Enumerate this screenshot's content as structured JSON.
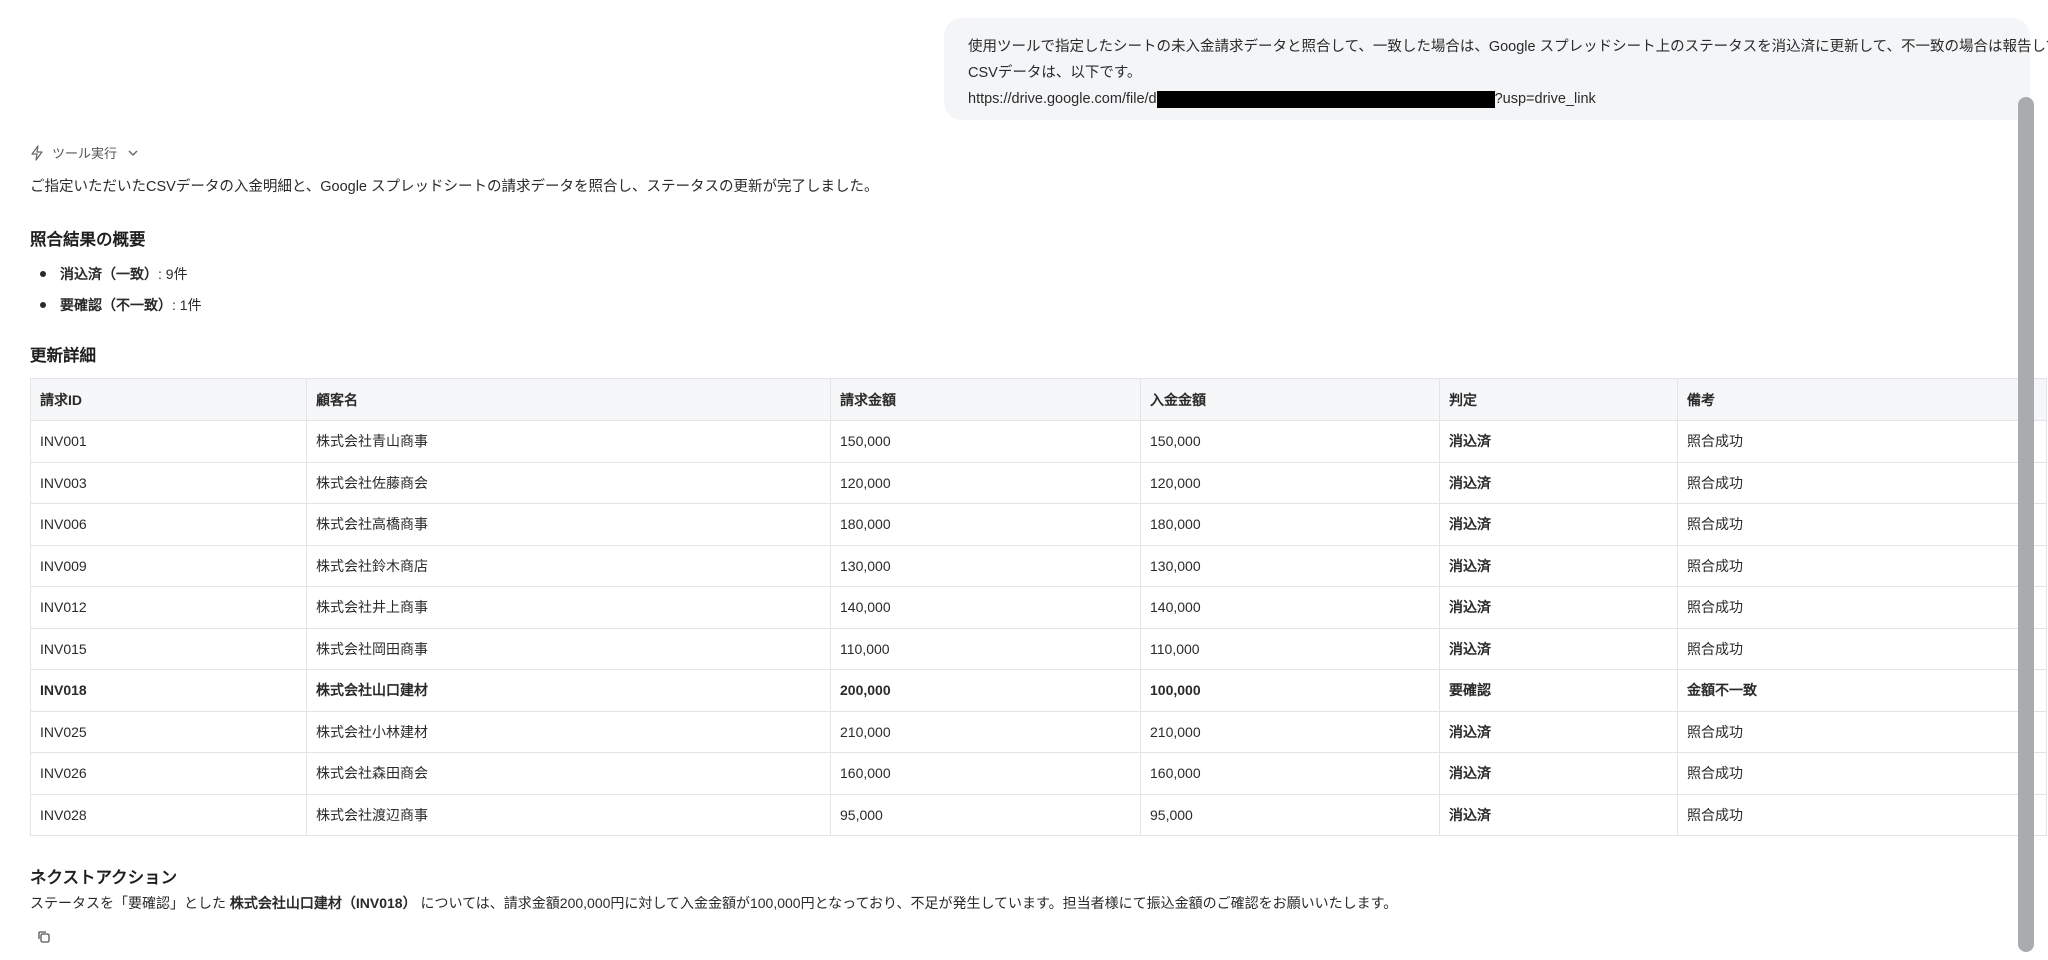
{
  "user_message": {
    "line1": "使用ツールで指定したシートの未入金請求データと照合して、一致した場合は、Google スプレッドシート上のステータスを消込済に更新して、不一致の場合は報告して。",
    "line2": "CSVデータは、以下です。",
    "url_prefix": "https://drive.google.com/file/d",
    "url_suffix": "?usp=drive_link"
  },
  "tool_toggle": {
    "label": "ツール実行",
    "icon": "bolt-icon",
    "chevron_icon": "chevron-down-icon"
  },
  "intro": "ご指定いただいたCSVデータの入金明細と、Google スプレッドシートの請求データを照合し、ステータスの更新が完了しました。",
  "summary": {
    "heading": "照合結果の概要",
    "items": [
      {
        "label": "消込済（一致）",
        "value": ": 9件"
      },
      {
        "label": "要確認（不一致）",
        "value": ": 1件"
      }
    ]
  },
  "details": {
    "heading": "更新詳細",
    "columns": [
      "請求ID",
      "顧客名",
      "請求金額",
      "入金金額",
      "判定",
      "備考"
    ],
    "rows": [
      [
        "INV001",
        "株式会社青山商事",
        "150,000",
        "150,000",
        "消込済",
        "照合成功"
      ],
      [
        "INV003",
        "株式会社佐藤商会",
        "120,000",
        "120,000",
        "消込済",
        "照合成功"
      ],
      [
        "INV006",
        "株式会社高橋商事",
        "180,000",
        "180,000",
        "消込済",
        "照合成功"
      ],
      [
        "INV009",
        "株式会社鈴木商店",
        "130,000",
        "130,000",
        "消込済",
        "照合成功"
      ],
      [
        "INV012",
        "株式会社井上商事",
        "140,000",
        "140,000",
        "消込済",
        "照合成功"
      ],
      [
        "INV015",
        "株式会社岡田商事",
        "110,000",
        "110,000",
        "消込済",
        "照合成功"
      ],
      [
        "INV018",
        "株式会社山口建材",
        "200,000",
        "100,000",
        "要確認",
        "金額不一致"
      ],
      [
        "INV025",
        "株式会社小林建材",
        "210,000",
        "210,000",
        "消込済",
        "照合成功"
      ],
      [
        "INV026",
        "株式会社森田商会",
        "160,000",
        "160,000",
        "消込済",
        "照合成功"
      ],
      [
        "INV028",
        "株式会社渡辺商事",
        "95,000",
        "95,000",
        "消込済",
        "照合成功"
      ]
    ]
  },
  "next_action": {
    "heading": "ネクストアクション",
    "text_before": "ステータスを「要確認」とした ",
    "text_bold": "株式会社山口建材（INV018）",
    "text_after": " については、請求金額200,000円に対して入金金額が100,000円となっており、不足が発生しています。担当者様にて振込金額のご確認をお願いいたします。"
  },
  "copy_icon": "copy-icon"
}
